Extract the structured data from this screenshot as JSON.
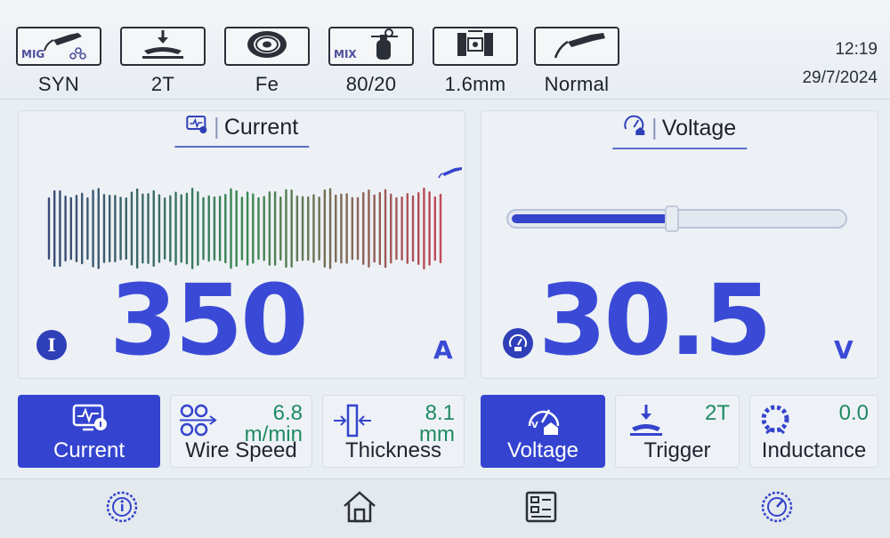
{
  "status_bar": {
    "items": [
      {
        "label": "SYN",
        "icon": "mig-torch-synergic-icon",
        "tag": "MIG"
      },
      {
        "label": "2T",
        "icon": "trigger-2t-icon",
        "tag": ""
      },
      {
        "label": "Fe",
        "icon": "wire-spool-icon",
        "tag": ""
      },
      {
        "label": "80/20",
        "icon": "gas-cylinder-mix-icon",
        "tag": "MIX"
      },
      {
        "label": "1.6mm",
        "icon": "wire-diameter-icon",
        "tag": ""
      },
      {
        "label": "Normal",
        "icon": "welding-torch-icon",
        "tag": ""
      }
    ],
    "time": "12:19",
    "date": "29/7/2024"
  },
  "current_panel": {
    "title": "Current",
    "value": "350",
    "unit": "A",
    "badge": "I",
    "waveform_colors": [
      "#3b4a78",
      "#3a8a52",
      "#c2485a"
    ]
  },
  "voltage_panel": {
    "title": "Voltage",
    "value": "30.5",
    "unit": "V",
    "slider_fraction": 0.49
  },
  "cards": [
    {
      "id": "current",
      "label": "Current",
      "value": "",
      "unit": "",
      "active": true,
      "icon": "current-monitor-icon"
    },
    {
      "id": "wire-speed",
      "label": "Wire Speed",
      "value": "6.8",
      "unit": "m/min",
      "active": false,
      "icon": "wire-feed-rollers-icon"
    },
    {
      "id": "thickness",
      "label": "Thickness",
      "value": "8.1",
      "unit": "mm",
      "active": false,
      "icon": "thickness-icon"
    },
    {
      "id": "voltage",
      "label": "Voltage",
      "value": "",
      "unit": "",
      "active": true,
      "icon": "voltage-gauge-icon"
    },
    {
      "id": "trigger",
      "label": "Trigger",
      "value": "2T",
      "unit": "",
      "active": false,
      "icon": "trigger-icon"
    },
    {
      "id": "inductance",
      "label": "Inductance",
      "value": "0.0",
      "unit": "",
      "active": false,
      "icon": "inductance-coil-icon"
    }
  ],
  "nav": [
    "info-dial-icon",
    "home-icon",
    "menu-grid-icon",
    "settings-dial-icon"
  ],
  "colors": {
    "accent": "#3444d0",
    "value_green": "#1f8a62",
    "number_blue": "#3a4ad6"
  }
}
